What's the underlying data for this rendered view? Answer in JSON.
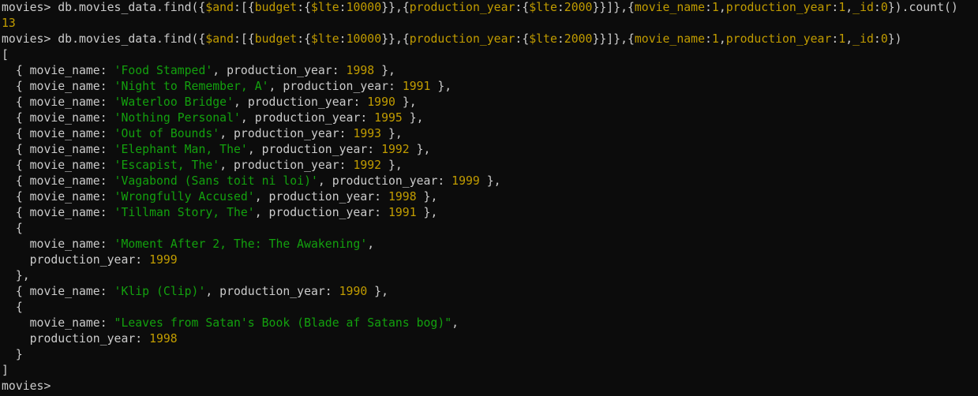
{
  "terminal": {
    "colors": {
      "background": "#0c0c0c",
      "text": "#cccccc",
      "operator_yellow": "#c19c00",
      "string_green": "#13a10e",
      "number_yellow": "#c19c00"
    },
    "lines": [
      [
        {
          "t": "movies> db.movies_data.find({",
          "c": "default"
        },
        {
          "t": "$and",
          "c": "op"
        },
        {
          "t": ":[{",
          "c": "default"
        },
        {
          "t": "budget",
          "c": "op"
        },
        {
          "t": ":{",
          "c": "default"
        },
        {
          "t": "$lte",
          "c": "op"
        },
        {
          "t": ":",
          "c": "default"
        },
        {
          "t": "10000",
          "c": "num"
        },
        {
          "t": "}},{",
          "c": "default"
        },
        {
          "t": "production_year",
          "c": "op"
        },
        {
          "t": ":{",
          "c": "default"
        },
        {
          "t": "$lte",
          "c": "op"
        },
        {
          "t": ":",
          "c": "default"
        },
        {
          "t": "2000",
          "c": "num"
        },
        {
          "t": "}}]},{",
          "c": "default"
        },
        {
          "t": "movie_name",
          "c": "op"
        },
        {
          "t": ":",
          "c": "default"
        },
        {
          "t": "1",
          "c": "num"
        },
        {
          "t": ",",
          "c": "default"
        },
        {
          "t": "production_year",
          "c": "op"
        },
        {
          "t": ":",
          "c": "default"
        },
        {
          "t": "1",
          "c": "num"
        },
        {
          "t": ",",
          "c": "default"
        },
        {
          "t": "_id",
          "c": "op"
        },
        {
          "t": ":",
          "c": "default"
        },
        {
          "t": "0",
          "c": "num"
        },
        {
          "t": "}).count()",
          "c": "default"
        }
      ],
      [
        {
          "t": "13",
          "c": "num"
        }
      ],
      [
        {
          "t": "movies> db.movies_data.find({",
          "c": "default"
        },
        {
          "t": "$and",
          "c": "op"
        },
        {
          "t": ":[{",
          "c": "default"
        },
        {
          "t": "budget",
          "c": "op"
        },
        {
          "t": ":{",
          "c": "default"
        },
        {
          "t": "$lte",
          "c": "op"
        },
        {
          "t": ":",
          "c": "default"
        },
        {
          "t": "10000",
          "c": "num"
        },
        {
          "t": "}},{",
          "c": "default"
        },
        {
          "t": "production_year",
          "c": "op"
        },
        {
          "t": ":{",
          "c": "default"
        },
        {
          "t": "$lte",
          "c": "op"
        },
        {
          "t": ":",
          "c": "default"
        },
        {
          "t": "2000",
          "c": "num"
        },
        {
          "t": "}}]},{",
          "c": "default"
        },
        {
          "t": "movie_name",
          "c": "op"
        },
        {
          "t": ":",
          "c": "default"
        },
        {
          "t": "1",
          "c": "num"
        },
        {
          "t": ",",
          "c": "default"
        },
        {
          "t": "production_year",
          "c": "op"
        },
        {
          "t": ":",
          "c": "default"
        },
        {
          "t": "1",
          "c": "num"
        },
        {
          "t": ",",
          "c": "default"
        },
        {
          "t": "_id",
          "c": "op"
        },
        {
          "t": ":",
          "c": "default"
        },
        {
          "t": "0",
          "c": "num"
        },
        {
          "t": "})",
          "c": "default"
        }
      ],
      [
        {
          "t": "[",
          "c": "default"
        }
      ],
      [
        {
          "t": "  { movie_name: ",
          "c": "default"
        },
        {
          "t": "'Food Stamped'",
          "c": "str"
        },
        {
          "t": ", production_year: ",
          "c": "default"
        },
        {
          "t": "1998",
          "c": "num"
        },
        {
          "t": " },",
          "c": "default"
        }
      ],
      [
        {
          "t": "  { movie_name: ",
          "c": "default"
        },
        {
          "t": "'Night to Remember, A'",
          "c": "str"
        },
        {
          "t": ", production_year: ",
          "c": "default"
        },
        {
          "t": "1991",
          "c": "num"
        },
        {
          "t": " },",
          "c": "default"
        }
      ],
      [
        {
          "t": "  { movie_name: ",
          "c": "default"
        },
        {
          "t": "'Waterloo Bridge'",
          "c": "str"
        },
        {
          "t": ", production_year: ",
          "c": "default"
        },
        {
          "t": "1990",
          "c": "num"
        },
        {
          "t": " },",
          "c": "default"
        }
      ],
      [
        {
          "t": "  { movie_name: ",
          "c": "default"
        },
        {
          "t": "'Nothing Personal'",
          "c": "str"
        },
        {
          "t": ", production_year: ",
          "c": "default"
        },
        {
          "t": "1995",
          "c": "num"
        },
        {
          "t": " },",
          "c": "default"
        }
      ],
      [
        {
          "t": "  { movie_name: ",
          "c": "default"
        },
        {
          "t": "'Out of Bounds'",
          "c": "str"
        },
        {
          "t": ", production_year: ",
          "c": "default"
        },
        {
          "t": "1993",
          "c": "num"
        },
        {
          "t": " },",
          "c": "default"
        }
      ],
      [
        {
          "t": "  { movie_name: ",
          "c": "default"
        },
        {
          "t": "'Elephant Man, The'",
          "c": "str"
        },
        {
          "t": ", production_year: ",
          "c": "default"
        },
        {
          "t": "1992",
          "c": "num"
        },
        {
          "t": " },",
          "c": "default"
        }
      ],
      [
        {
          "t": "  { movie_name: ",
          "c": "default"
        },
        {
          "t": "'Escapist, The'",
          "c": "str"
        },
        {
          "t": ", production_year: ",
          "c": "default"
        },
        {
          "t": "1992",
          "c": "num"
        },
        {
          "t": " },",
          "c": "default"
        }
      ],
      [
        {
          "t": "  { movie_name: ",
          "c": "default"
        },
        {
          "t": "'Vagabond (Sans toit ni loi)'",
          "c": "str"
        },
        {
          "t": ", production_year: ",
          "c": "default"
        },
        {
          "t": "1999",
          "c": "num"
        },
        {
          "t": " },",
          "c": "default"
        }
      ],
      [
        {
          "t": "  { movie_name: ",
          "c": "default"
        },
        {
          "t": "'Wrongfully Accused'",
          "c": "str"
        },
        {
          "t": ", production_year: ",
          "c": "default"
        },
        {
          "t": "1998",
          "c": "num"
        },
        {
          "t": " },",
          "c": "default"
        }
      ],
      [
        {
          "t": "  { movie_name: ",
          "c": "default"
        },
        {
          "t": "'Tillman Story, The'",
          "c": "str"
        },
        {
          "t": ", production_year: ",
          "c": "default"
        },
        {
          "t": "1991",
          "c": "num"
        },
        {
          "t": " },",
          "c": "default"
        }
      ],
      [
        {
          "t": "  {",
          "c": "default"
        }
      ],
      [
        {
          "t": "    movie_name: ",
          "c": "default"
        },
        {
          "t": "'Moment After 2, The: The Awakening'",
          "c": "str"
        },
        {
          "t": ",",
          "c": "default"
        }
      ],
      [
        {
          "t": "    production_year: ",
          "c": "default"
        },
        {
          "t": "1999",
          "c": "num"
        }
      ],
      [
        {
          "t": "  },",
          "c": "default"
        }
      ],
      [
        {
          "t": "  { movie_name: ",
          "c": "default"
        },
        {
          "t": "'Klip (Clip)'",
          "c": "str"
        },
        {
          "t": ", production_year: ",
          "c": "default"
        },
        {
          "t": "1990",
          "c": "num"
        },
        {
          "t": " },",
          "c": "default"
        }
      ],
      [
        {
          "t": "  {",
          "c": "default"
        }
      ],
      [
        {
          "t": "    movie_name: ",
          "c": "default"
        },
        {
          "t": "\"Leaves from Satan's Book (Blade af Satans bog)\"",
          "c": "str"
        },
        {
          "t": ",",
          "c": "default"
        }
      ],
      [
        {
          "t": "    production_year: ",
          "c": "default"
        },
        {
          "t": "1998",
          "c": "num"
        }
      ],
      [
        {
          "t": "  }",
          "c": "default"
        }
      ],
      [
        {
          "t": "]",
          "c": "default"
        }
      ],
      [
        {
          "t": "movies>",
          "c": "default"
        },
        {
          "t": " ",
          "c": "default"
        }
      ]
    ]
  }
}
